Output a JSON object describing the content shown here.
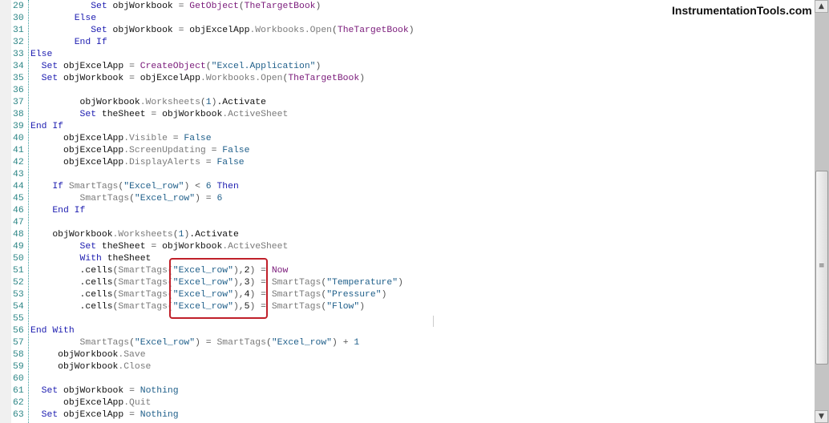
{
  "brand": "InstrumentationTools.com",
  "scrollbar": {
    "up_icon": "▲",
    "down_icon": "▼",
    "grip_icon": "≡",
    "position_percent": 57
  },
  "highlight_color": "#c0202a",
  "lines": [
    {
      "n": "29",
      "t": [
        [
          "           ",
          "v"
        ],
        [
          "Set",
          "k"
        ],
        [
          " objWorkbook ",
          "v"
        ],
        [
          "=",
          "o"
        ],
        [
          " ",
          "v"
        ],
        [
          "GetObject",
          "f"
        ],
        [
          "(",
          "o"
        ],
        [
          "TheTargetBook",
          "a"
        ],
        [
          ")",
          "o"
        ]
      ]
    },
    {
      "n": "30",
      "t": [
        [
          "        ",
          "v"
        ],
        [
          "Else",
          "k"
        ]
      ]
    },
    {
      "n": "31",
      "t": [
        [
          "           ",
          "v"
        ],
        [
          "Set",
          "k"
        ],
        [
          " objWorkbook ",
          "v"
        ],
        [
          "=",
          "o"
        ],
        [
          " objExcelApp",
          "v"
        ],
        [
          ".Workbooks.Open",
          "p"
        ],
        [
          "(",
          "o"
        ],
        [
          "TheTargetBook",
          "a"
        ],
        [
          ")",
          "o"
        ]
      ]
    },
    {
      "n": "32",
      "t": [
        [
          "        ",
          "v"
        ],
        [
          "End If",
          "k"
        ]
      ]
    },
    {
      "n": "33",
      "t": [
        [
          "Else",
          "k"
        ]
      ]
    },
    {
      "n": "34",
      "t": [
        [
          "  ",
          "v"
        ],
        [
          "Set",
          "k"
        ],
        [
          " objExcelApp ",
          "v"
        ],
        [
          "=",
          "o"
        ],
        [
          " ",
          "v"
        ],
        [
          "CreateObject",
          "f"
        ],
        [
          "(",
          "o"
        ],
        [
          "\"Excel.Application\"",
          "s"
        ],
        [
          ")",
          "o"
        ]
      ]
    },
    {
      "n": "35",
      "t": [
        [
          "  ",
          "v"
        ],
        [
          "Set",
          "k"
        ],
        [
          " objWorkbook ",
          "v"
        ],
        [
          "=",
          "o"
        ],
        [
          " objExcelApp",
          "v"
        ],
        [
          ".Workbooks.Open",
          "p"
        ],
        [
          "(",
          "o"
        ],
        [
          "TheTargetBook",
          "a"
        ],
        [
          ")",
          "o"
        ]
      ]
    },
    {
      "n": "36",
      "t": []
    },
    {
      "n": "37",
      "t": [
        [
          "         objWorkbook",
          "v"
        ],
        [
          ".Worksheets",
          "p"
        ],
        [
          "(",
          "o"
        ],
        [
          "1",
          "n"
        ],
        [
          ")",
          "o"
        ],
        [
          ".Activate",
          "v"
        ]
      ]
    },
    {
      "n": "38",
      "t": [
        [
          "         ",
          "v"
        ],
        [
          "Set",
          "k"
        ],
        [
          " theSheet ",
          "v"
        ],
        [
          "=",
          "o"
        ],
        [
          " objWorkbook",
          "v"
        ],
        [
          ".ActiveSheet",
          "p"
        ]
      ]
    },
    {
      "n": "39",
      "t": [
        [
          "End If",
          "k"
        ]
      ]
    },
    {
      "n": "40",
      "t": [
        [
          "      objExcelApp",
          "v"
        ],
        [
          ".Visible",
          "p"
        ],
        [
          " = ",
          "o"
        ],
        [
          "False",
          "n"
        ]
      ]
    },
    {
      "n": "41",
      "t": [
        [
          "      objExcelApp",
          "v"
        ],
        [
          ".ScreenUpdating",
          "p"
        ],
        [
          " = ",
          "o"
        ],
        [
          "False",
          "n"
        ]
      ]
    },
    {
      "n": "42",
      "t": [
        [
          "      objExcelApp",
          "v"
        ],
        [
          ".DisplayAlerts",
          "p"
        ],
        [
          " = ",
          "o"
        ],
        [
          "False",
          "n"
        ]
      ]
    },
    {
      "n": "43",
      "t": []
    },
    {
      "n": "44",
      "t": [
        [
          "    ",
          "v"
        ],
        [
          "If",
          "k"
        ],
        [
          " ",
          "v"
        ],
        [
          "SmartTags",
          "p"
        ],
        [
          "(",
          "o"
        ],
        [
          "\"Excel_row\"",
          "s"
        ],
        [
          ") < ",
          "o"
        ],
        [
          "6",
          "n"
        ],
        [
          " ",
          "v"
        ],
        [
          "Then",
          "k"
        ]
      ]
    },
    {
      "n": "45",
      "t": [
        [
          "         ",
          "v"
        ],
        [
          "SmartTags",
          "p"
        ],
        [
          "(",
          "o"
        ],
        [
          "\"Excel_row\"",
          "s"
        ],
        [
          ") = ",
          "o"
        ],
        [
          "6",
          "n"
        ]
      ]
    },
    {
      "n": "46",
      "t": [
        [
          "    ",
          "v"
        ],
        [
          "End If",
          "k"
        ]
      ]
    },
    {
      "n": "47",
      "t": []
    },
    {
      "n": "48",
      "t": [
        [
          "    objWorkbook",
          "v"
        ],
        [
          ".Worksheets",
          "p"
        ],
        [
          "(",
          "o"
        ],
        [
          "1",
          "n"
        ],
        [
          ")",
          "o"
        ],
        [
          ".Activate",
          "v"
        ]
      ]
    },
    {
      "n": "49",
      "t": [
        [
          "         ",
          "v"
        ],
        [
          "Set",
          "k"
        ],
        [
          " theSheet ",
          "v"
        ],
        [
          "=",
          "o"
        ],
        [
          " objWorkbook",
          "v"
        ],
        [
          ".ActiveSheet",
          "p"
        ]
      ]
    },
    {
      "n": "50",
      "t": [
        [
          "         ",
          "v"
        ],
        [
          "With",
          "k"
        ],
        [
          " theSheet",
          "v"
        ]
      ]
    },
    {
      "n": "51",
      "t": [
        [
          "         .cells",
          "v"
        ],
        [
          "(",
          "o"
        ],
        [
          "SmartTags",
          "p"
        ],
        [
          "(",
          "o"
        ],
        [
          "\"Excel_row\"",
          "s"
        ],
        [
          "),",
          "o"
        ],
        [
          "2",
          "v"
        ],
        [
          ") = ",
          "o"
        ],
        [
          "Now",
          "f"
        ]
      ]
    },
    {
      "n": "52",
      "t": [
        [
          "         .cells",
          "v"
        ],
        [
          "(",
          "o"
        ],
        [
          "SmartTags",
          "p"
        ],
        [
          "(",
          "o"
        ],
        [
          "\"Excel_row\"",
          "s"
        ],
        [
          "),",
          "o"
        ],
        [
          "3",
          "v"
        ],
        [
          ") = ",
          "o"
        ],
        [
          "SmartTags",
          "p"
        ],
        [
          "(",
          "o"
        ],
        [
          "\"Temperature\"",
          "s"
        ],
        [
          ")",
          "o"
        ]
      ]
    },
    {
      "n": "53",
      "t": [
        [
          "         .cells",
          "v"
        ],
        [
          "(",
          "o"
        ],
        [
          "SmartTags",
          "p"
        ],
        [
          "(",
          "o"
        ],
        [
          "\"Excel_row\"",
          "s"
        ],
        [
          "),",
          "o"
        ],
        [
          "4",
          "v"
        ],
        [
          ") = ",
          "o"
        ],
        [
          "SmartTags",
          "p"
        ],
        [
          "(",
          "o"
        ],
        [
          "\"Pressure\"",
          "s"
        ],
        [
          ")",
          "o"
        ]
      ]
    },
    {
      "n": "54",
      "t": [
        [
          "         .cells",
          "v"
        ],
        [
          "(",
          "o"
        ],
        [
          "SmartTags",
          "p"
        ],
        [
          "(",
          "o"
        ],
        [
          "\"Excel_row\"",
          "s"
        ],
        [
          "),",
          "o"
        ],
        [
          "5",
          "v"
        ],
        [
          ") = ",
          "o"
        ],
        [
          "SmartTags",
          "p"
        ],
        [
          "(",
          "o"
        ],
        [
          "\"Flow\"",
          "s"
        ],
        [
          ")",
          "o"
        ]
      ]
    },
    {
      "n": "55",
      "t": []
    },
    {
      "n": "56",
      "t": [
        [
          "End With",
          "k"
        ]
      ]
    },
    {
      "n": "57",
      "t": [
        [
          "         ",
          "v"
        ],
        [
          "SmartTags",
          "p"
        ],
        [
          "(",
          "o"
        ],
        [
          "\"Excel_row\"",
          "s"
        ],
        [
          ") = ",
          "o"
        ],
        [
          "SmartTags",
          "p"
        ],
        [
          "(",
          "o"
        ],
        [
          "\"Excel_row\"",
          "s"
        ],
        [
          ") + ",
          "o"
        ],
        [
          "1",
          "n"
        ]
      ]
    },
    {
      "n": "58",
      "t": [
        [
          "     objWorkbook",
          "v"
        ],
        [
          ".Save",
          "p"
        ]
      ]
    },
    {
      "n": "59",
      "t": [
        [
          "     objWorkbook",
          "v"
        ],
        [
          ".Close",
          "p"
        ]
      ]
    },
    {
      "n": "60",
      "t": []
    },
    {
      "n": "61",
      "t": [
        [
          "  ",
          "v"
        ],
        [
          "Set",
          "k"
        ],
        [
          " objWorkbook ",
          "v"
        ],
        [
          "=",
          "o"
        ],
        [
          " ",
          "v"
        ],
        [
          "Nothing",
          "n"
        ]
      ]
    },
    {
      "n": "62",
      "t": [
        [
          "      objExcelApp",
          "v"
        ],
        [
          ".Quit",
          "p"
        ]
      ]
    },
    {
      "n": "63",
      "t": [
        [
          "  ",
          "v"
        ],
        [
          "Set",
          "k"
        ],
        [
          " objExcelApp ",
          "v"
        ],
        [
          "=",
          "o"
        ],
        [
          " ",
          "v"
        ],
        [
          "Nothing",
          "n"
        ]
      ]
    }
  ]
}
